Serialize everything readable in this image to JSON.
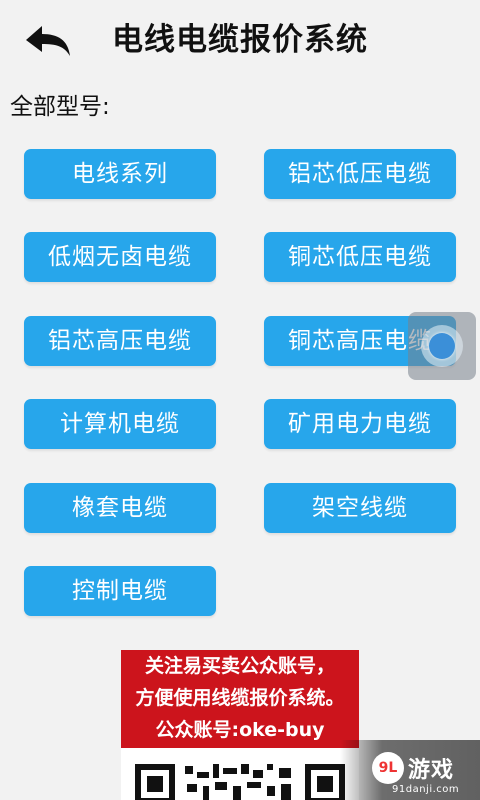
{
  "header": {
    "title": "电线电缆报价系统",
    "back_icon": "back-arrow-icon"
  },
  "section": {
    "label": "全部型号:"
  },
  "models": [
    {
      "label": "电线系列"
    },
    {
      "label": "铝芯低压电缆"
    },
    {
      "label": "低烟无卤电缆"
    },
    {
      "label": "铜芯低压电缆"
    },
    {
      "label": "铝芯高压电缆"
    },
    {
      "label": "铜芯高压电缆"
    },
    {
      "label": "计算机电缆"
    },
    {
      "label": "矿用电力电缆"
    },
    {
      "label": "橡套电缆"
    },
    {
      "label": "架空线缆"
    },
    {
      "label": "控制电缆"
    }
  ],
  "promo": {
    "line1": "关注易买卖公众账号，",
    "line2": "方便使用线缆报价系统。",
    "line3": "公众账号:oke-buy"
  },
  "watermark": {
    "logo": "9L",
    "text": "游戏",
    "url": "91danji.com"
  },
  "colors": {
    "button_bg": "#27a6eb",
    "promo_bg": "#cc141c",
    "page_bg": "#f2f2f2"
  }
}
